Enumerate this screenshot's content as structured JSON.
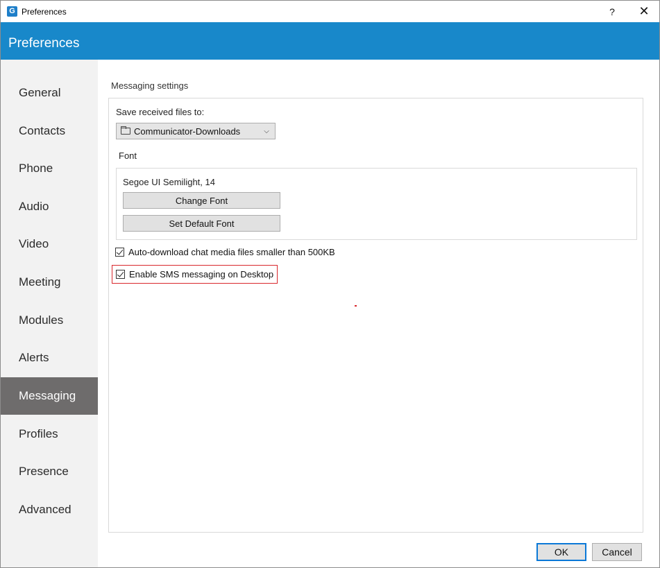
{
  "window": {
    "title": "Preferences",
    "help_glyph": "?",
    "close_glyph": "✕",
    "app_icon_letter": "G"
  },
  "header": {
    "title": "Preferences",
    "accent_color": "#1888ca"
  },
  "sidebar": {
    "items": [
      {
        "label": "General"
      },
      {
        "label": "Contacts"
      },
      {
        "label": "Phone"
      },
      {
        "label": "Audio"
      },
      {
        "label": "Video"
      },
      {
        "label": "Meeting"
      },
      {
        "label": "Modules"
      },
      {
        "label": "Alerts"
      },
      {
        "label": "Messaging",
        "active": true
      },
      {
        "label": "Profiles"
      },
      {
        "label": "Presence"
      },
      {
        "label": "Advanced"
      }
    ]
  },
  "messaging": {
    "section_title": "Messaging settings",
    "save_files_label": "Save received files to:",
    "save_folder_value": "Communicator-Downloads",
    "font_label": "Font",
    "current_font": "Segoe UI Semilight, 14",
    "change_font_button": "Change Font",
    "default_font_button": "Set Default Font",
    "auto_download_label": "Auto-download chat media files smaller than 500KB",
    "auto_download_checked": true,
    "sms_label": "Enable SMS messaging on Desktop",
    "sms_checked": true,
    "highlight_color": "#d9262b"
  },
  "footer": {
    "ok_label": "OK",
    "cancel_label": "Cancel"
  },
  "icons": {
    "folder": "folder-icon",
    "dropdown": "chevron-down-icon"
  }
}
